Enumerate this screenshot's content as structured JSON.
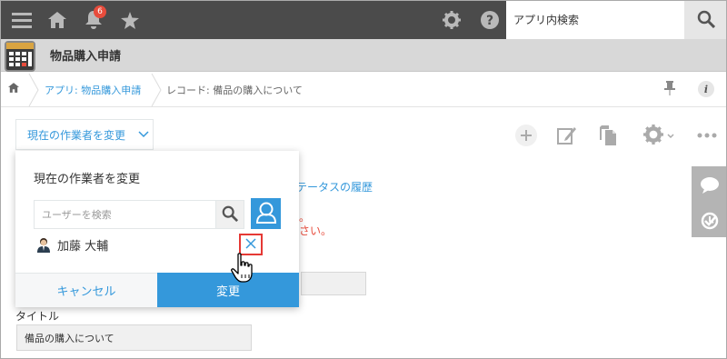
{
  "topbar": {
    "search_placeholder": "アプリ内検索",
    "notification_count": "6"
  },
  "app": {
    "title": "物品購入申請"
  },
  "breadcrumb": {
    "app_link": "アプリ: 物品購入申請",
    "record": "レコード: 備品の購入について"
  },
  "toolbar": {
    "change_assignee_label": "現在の作業者を変更"
  },
  "dialog": {
    "title": "現在の作業者を変更",
    "search_placeholder": "ユーザーを検索",
    "selected_user": "加藤 大輔",
    "cancel_label": "キャンセル",
    "ok_label": "変更"
  },
  "background": {
    "status_history_link": "テータスの履歴",
    "error_line1": "。",
    "error_line2": "さい。",
    "title_label": "タイトル",
    "title_value": "備品の購入について"
  },
  "colors": {
    "accent": "#3498db",
    "topbar": "#4b4b4b",
    "error": "#e74c3c"
  },
  "icons": [
    "menu-icon",
    "home-icon",
    "bell-icon",
    "star-icon",
    "gear-icon",
    "help-icon",
    "search-icon",
    "pin-icon",
    "info-icon",
    "plus-icon",
    "edit-icon",
    "copy-icon",
    "chevron-down-icon",
    "more-icon",
    "comment-icon",
    "history-icon",
    "user-icon",
    "close-icon",
    "hand-cursor-icon"
  ]
}
